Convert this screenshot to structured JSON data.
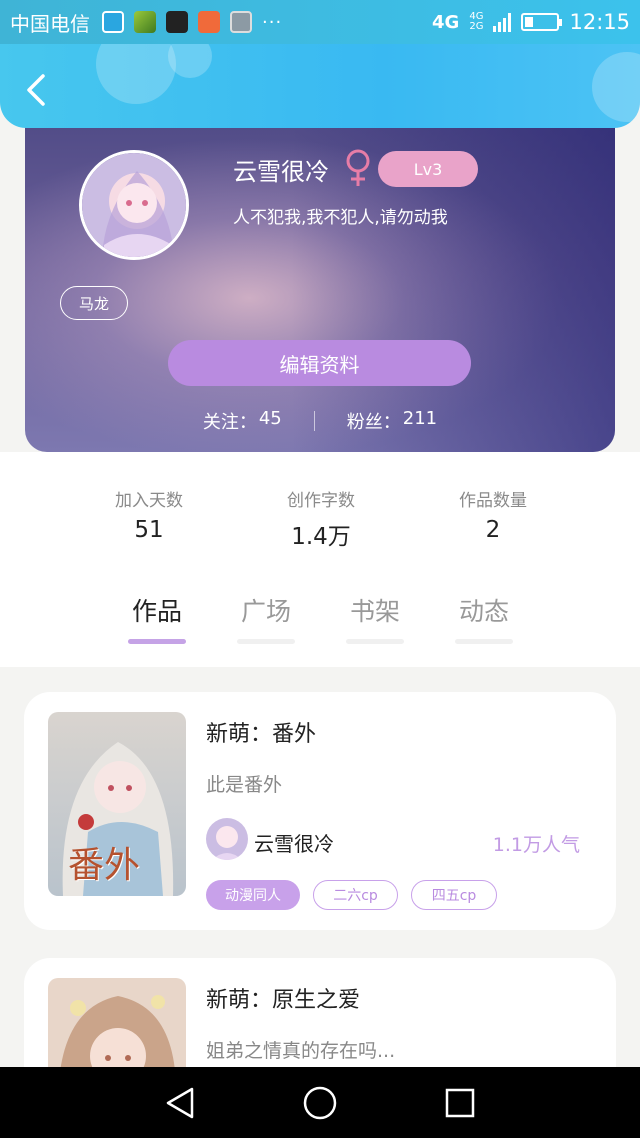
{
  "status_bar": {
    "carrier": "中国电信",
    "more": "···",
    "network": "4G",
    "network_sub_top": "4G",
    "network_sub_bottom": "2G",
    "battery_level": 0.25,
    "time": "12:15"
  },
  "header": {
    "back_icon": "chevron-left-icon"
  },
  "profile": {
    "nickname": "云雪很冷",
    "gender": "female",
    "gender_symbol": "♀",
    "level": "Lv3",
    "signature": "人不犯我,我不犯人,请勿动我",
    "tag": "马龙",
    "edit_button": "编辑资料",
    "following_label": "关注：",
    "following_count": "45",
    "followers_label": "粉丝：",
    "followers_count": "211"
  },
  "stats": [
    {
      "label": "加入天数",
      "value": "51"
    },
    {
      "label": "创作字数",
      "value": "1.4万"
    },
    {
      "label": "作品数量",
      "value": "2"
    }
  ],
  "tabs": [
    {
      "label": "作品",
      "active": true
    },
    {
      "label": "广场",
      "active": false
    },
    {
      "label": "书架",
      "active": false
    },
    {
      "label": "动态",
      "active": false
    }
  ],
  "works": [
    {
      "title": "新萌：番外",
      "description": "此是番外",
      "author": "云雪很冷",
      "popularity": "1.1万人气",
      "cover_text": "番外",
      "tags": [
        "动漫同人",
        "二六cp",
        "四五cp"
      ]
    },
    {
      "title": "新萌：原生之爱",
      "description": "姐弟之情真的存在吗..."
    }
  ],
  "nav": {
    "back_icon": "triangle-back-icon",
    "home_icon": "circle-home-icon",
    "recents_icon": "square-recents-icon"
  },
  "colors": {
    "accent": "#c8a1ea",
    "header_blue": "#39b9f2",
    "level_badge": "#e9a3c9",
    "gender": "#e77da7"
  }
}
